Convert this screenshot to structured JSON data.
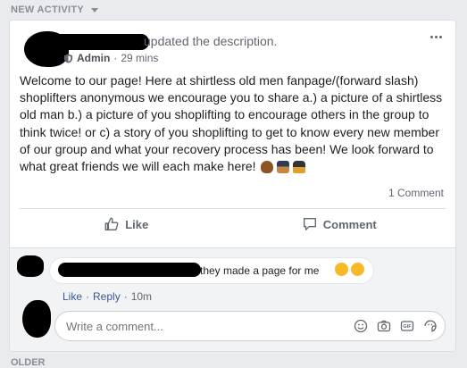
{
  "section": {
    "title": "NEW ACTIVITY"
  },
  "post": {
    "header_text": "updated the description.",
    "role": "Admin",
    "time": "29 mins",
    "body": "Welcome to our page! Here at shirtless old men fanpage/(forward slash) shoplifters anonymous we encourage you to share a.) a picture of a shirtless old man b.) a picture of you shoplifting to encourage others in the group to think twice! or c) a story of you shoplifting to get to know every new member of our group and what your recovery process has been! We look forward to what great friends we will each make here!",
    "comment_count": "1 Comment",
    "like_label": "Like",
    "comment_label": "Comment"
  },
  "comment": {
    "text": "they made a page for me",
    "like_label": "Like",
    "reply_label": "Reply",
    "time": "10m"
  },
  "composer": {
    "placeholder": "Write a comment..."
  },
  "footer": {
    "older_label": "OLDER"
  },
  "icons": [
    "chevron-down-icon",
    "shield-icon",
    "more-icon",
    "like-icon",
    "comment-icon",
    "emoji-icon",
    "camera-icon",
    "gif-icon",
    "sticker-icon"
  ]
}
